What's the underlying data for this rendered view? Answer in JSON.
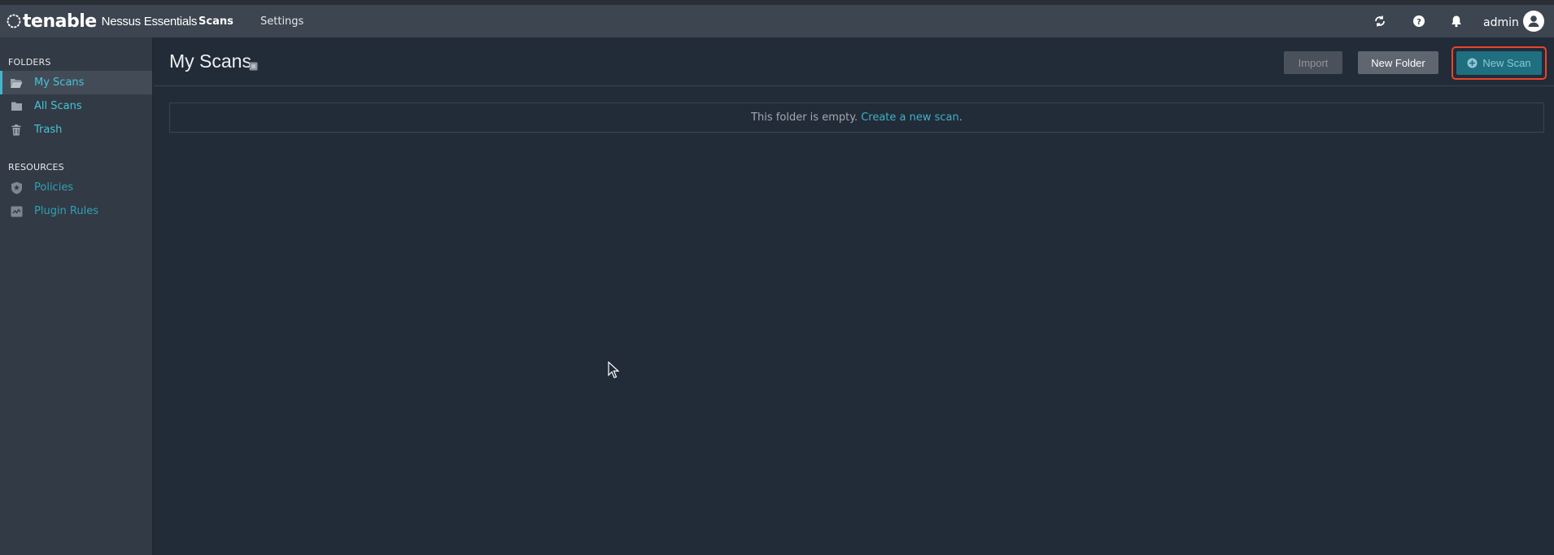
{
  "brand": {
    "logo_text": "tenable",
    "product": "Nessus Essentials"
  },
  "nav": {
    "tabs": [
      {
        "label": "Scans",
        "active": true
      },
      {
        "label": "Settings",
        "active": false
      }
    ]
  },
  "topbar": {
    "user": "admin",
    "icons": [
      "refresh-icon",
      "help-icon",
      "bell-icon",
      "user-avatar-icon"
    ]
  },
  "sidebar": {
    "folders_heading": "FOLDERS",
    "folders": [
      {
        "label": "My Scans",
        "icon": "folder-open-icon",
        "active": true
      },
      {
        "label": "All Scans",
        "icon": "folder-icon",
        "active": false
      },
      {
        "label": "Trash",
        "icon": "trash-icon",
        "active": false
      }
    ],
    "resources_heading": "RESOURCES",
    "resources": [
      {
        "label": "Policies",
        "icon": "shield-icon"
      },
      {
        "label": "Plugin Rules",
        "icon": "plugin-rules-icon"
      }
    ]
  },
  "main": {
    "title": "My Scans",
    "buttons": {
      "import": "Import",
      "new_folder": "New Folder",
      "new_scan": "New Scan"
    },
    "empty_text": "This folder is empty.",
    "empty_link": "Create a new scan",
    "empty_suffix": "."
  },
  "colors": {
    "accent": "#44b5c9",
    "highlight": "#e8462a",
    "topbar": "#3d4550",
    "sidebar": "#323a45",
    "background": "#222b38"
  }
}
